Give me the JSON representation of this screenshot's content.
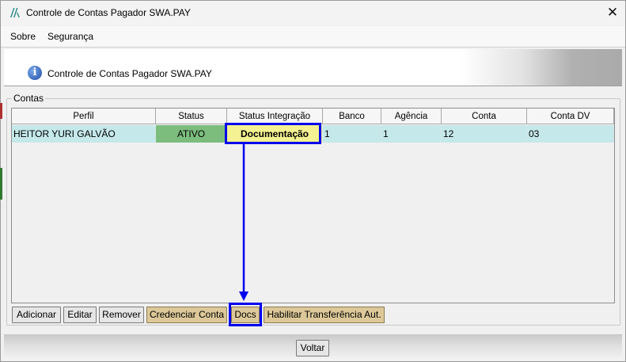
{
  "window": {
    "title": "Controle de Contas Pagador SWA.PAY",
    "close_glyph": "✕"
  },
  "menu": {
    "items": [
      {
        "label": "Sobre"
      },
      {
        "label": "Segurança"
      }
    ]
  },
  "header": {
    "title": "Controle de Contas Pagador SWA.PAY",
    "icon": "info-icon"
  },
  "group": {
    "legend": "Contas"
  },
  "table": {
    "columns": [
      "Perfil",
      "Status",
      "Status Integração",
      "Banco",
      "Agência",
      "Conta",
      "Conta DV"
    ],
    "rows": [
      {
        "perfil": "HEITOR YURI GALVÃO",
        "status": "ATIVO",
        "status_integracao": "Documentação",
        "banco": "1",
        "agencia": "1",
        "conta": "12",
        "conta_dv": "03"
      }
    ]
  },
  "buttons": {
    "adicionar": "Adicionar",
    "editar": "Editar",
    "remover": "Remover",
    "credenciar": "Credenciar Conta",
    "docs": "Docs",
    "habilitar": "Habilitar Transferência Aut.",
    "voltar": "Voltar"
  },
  "colors": {
    "status_ativo": "#7cbd7e",
    "status_integracao": "#f3f191",
    "row_selected": "#c5e8ea",
    "annotation": "#0000ee",
    "gold_button": "#dcc898"
  }
}
